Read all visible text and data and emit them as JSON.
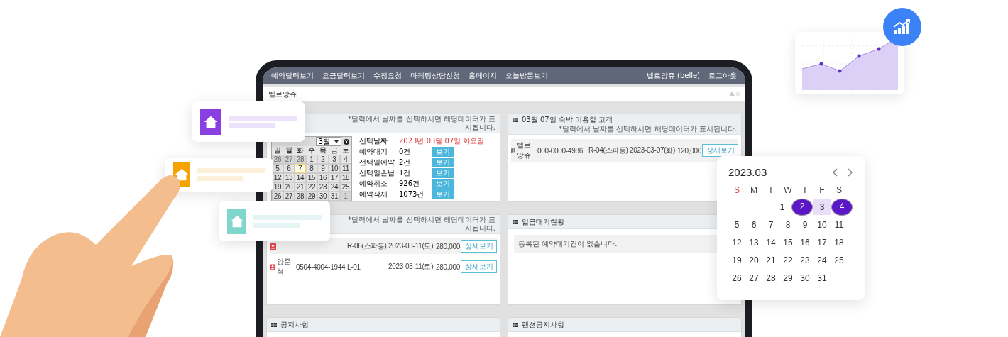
{
  "nav": {
    "items": [
      "예약달력보기",
      "요금달력보기",
      "수정요청",
      "마케팅상담신청",
      "홈페이지",
      "오늘방문보기"
    ],
    "user": "벨르망쥬 (belle)",
    "logout": "로그아웃"
  },
  "page_title": "벨르망쥬",
  "calendar_panel": {
    "note": "*달력에서 날짜를 선택하시면 해당데이터가 표시됩니다.",
    "month": "3월",
    "weekdays": [
      "일",
      "월",
      "화",
      "수",
      "목",
      "금",
      "토"
    ],
    "weeks": [
      [
        {
          "label": "26",
          "muted": true,
          "today": false
        },
        {
          "label": "27",
          "muted": true,
          "today": false
        },
        {
          "label": "28",
          "muted": true,
          "today": false
        },
        {
          "label": "1",
          "muted": false,
          "today": false
        },
        {
          "label": "2",
          "muted": false,
          "today": false
        },
        {
          "label": "3",
          "muted": false,
          "today": false
        },
        {
          "label": "4",
          "muted": false,
          "today": false
        }
      ],
      [
        {
          "label": "5",
          "muted": false,
          "today": false
        },
        {
          "label": "6",
          "muted": false,
          "today": false
        },
        {
          "label": "7",
          "muted": false,
          "today": true
        },
        {
          "label": "8",
          "muted": false,
          "today": false
        },
        {
          "label": "9",
          "muted": false,
          "today": false
        },
        {
          "label": "10",
          "muted": false,
          "today": false
        },
        {
          "label": "11",
          "muted": false,
          "today": false
        }
      ],
      [
        {
          "label": "12",
          "muted": false,
          "today": false
        },
        {
          "label": "13",
          "muted": false,
          "today": false
        },
        {
          "label": "14",
          "muted": false,
          "today": false
        },
        {
          "label": "15",
          "muted": false,
          "today": false
        },
        {
          "label": "16",
          "muted": false,
          "today": false
        },
        {
          "label": "17",
          "muted": false,
          "today": false
        },
        {
          "label": "18",
          "muted": false,
          "today": false
        }
      ],
      [
        {
          "label": "19",
          "muted": false,
          "today": false
        },
        {
          "label": "20",
          "muted": false,
          "today": false
        },
        {
          "label": "21",
          "muted": false,
          "today": false
        },
        {
          "label": "22",
          "muted": false,
          "today": false
        },
        {
          "label": "23",
          "muted": false,
          "today": false
        },
        {
          "label": "24",
          "muted": false,
          "today": false
        },
        {
          "label": "25",
          "muted": false,
          "today": false
        }
      ],
      [
        {
          "label": "26",
          "muted": false,
          "today": false
        },
        {
          "label": "27",
          "muted": false,
          "today": false
        },
        {
          "label": "28",
          "muted": false,
          "today": false
        },
        {
          "label": "29",
          "muted": false,
          "today": false
        },
        {
          "label": "30",
          "muted": false,
          "today": false
        },
        {
          "label": "31",
          "muted": false,
          "today": false
        },
        {
          "label": "1",
          "muted": true,
          "today": false
        }
      ]
    ],
    "selected_date_label": "선택날짜",
    "selected_date": "2023년 03월 07일 화요일",
    "stats": [
      {
        "label": "예약대기",
        "value": "0건",
        "button": "보기"
      },
      {
        "label": "선택일예약",
        "value": "2건",
        "button": "보기"
      },
      {
        "label": "선택일손님",
        "value": "1건",
        "button": "보기"
      },
      {
        "label": "예약취소",
        "value": "926건",
        "button": "보기"
      },
      {
        "label": "예약삭제",
        "value": "1073건",
        "button": "보기"
      }
    ]
  },
  "guests_panel": {
    "title": "03월 07일 숙박 이용할 고객",
    "note": "*달력에서 날짜를 선택하시면 해당데이터가 표시됩니다.",
    "rows": [
      {
        "name": "벨르망쥬",
        "phone": "000-0000-4986",
        "room": "R-04(스파동)",
        "date": "2023-03-07(화)",
        "price": "120,000",
        "button": "상세보기"
      }
    ]
  },
  "reservations_panel": {
    "note": "*달력에서 날짜를 선택하시면 해당데이터가 표시됩니다.",
    "rows": [
      {
        "room": "R-06(스파동)",
        "date": "2023-03-11(토)",
        "price": "280,000",
        "button": "상세보기"
      },
      {
        "name": "양준혁",
        "phone": "0504-4004-1944",
        "room": "L-01",
        "date": "2023-03-11(토)",
        "price": "280,000",
        "button": "상세보기"
      }
    ]
  },
  "deposit_panel": {
    "title": "입금대기현황",
    "message": "등록된 예약대기건이 없습니다."
  },
  "notice_panels": [
    {
      "title": "공지사항"
    },
    {
      "title": "펜션공지사항"
    }
  ],
  "date_picker": {
    "title": "2023.03",
    "weekdays": [
      {
        "label": "S",
        "kind": "sunday"
      },
      {
        "label": "M",
        "kind": "weekday"
      },
      {
        "label": "T",
        "kind": "weekday"
      },
      {
        "label": "W",
        "kind": "weekday"
      },
      {
        "label": "T",
        "kind": "weekday"
      },
      {
        "label": "F",
        "kind": "weekday"
      },
      {
        "label": "S",
        "kind": "weekday"
      }
    ],
    "weeks": [
      [
        {
          "label": "1",
          "selected": false,
          "in_range": false
        },
        {
          "label": "2",
          "selected": true,
          "in_range": false
        },
        {
          "label": "3",
          "selected": false,
          "in_range": true
        },
        {
          "label": "4",
          "selected": true,
          "in_range": false
        }
      ],
      [
        {
          "label": "5",
          "selected": false,
          "in_range": false
        },
        {
          "label": "6",
          "selected": false,
          "in_range": false
        },
        {
          "label": "7",
          "selected": false,
          "in_range": false
        },
        {
          "label": "8",
          "selected": false,
          "in_range": false
        },
        {
          "label": "9",
          "selected": false,
          "in_range": false
        },
        {
          "label": "10",
          "selected": false,
          "in_range": false
        },
        {
          "label": "11",
          "selected": false,
          "in_range": false
        }
      ],
      [
        {
          "label": "12",
          "selected": false,
          "in_range": false
        },
        {
          "label": "13",
          "selected": false,
          "in_range": false
        },
        {
          "label": "14",
          "selected": false,
          "in_range": false
        },
        {
          "label": "15",
          "selected": false,
          "in_range": false
        },
        {
          "label": "16",
          "selected": false,
          "in_range": false
        },
        {
          "label": "17",
          "selected": false,
          "in_range": false
        },
        {
          "label": "18",
          "selected": false,
          "in_range": false
        }
      ],
      [
        {
          "label": "19",
          "selected": false,
          "in_range": false
        },
        {
          "label": "20",
          "selected": false,
          "in_range": false
        },
        {
          "label": "21",
          "selected": false,
          "in_range": false
        },
        {
          "label": "22",
          "selected": false,
          "in_range": false
        },
        {
          "label": "23",
          "selected": false,
          "in_range": false
        },
        {
          "label": "24",
          "selected": false,
          "in_range": false
        },
        {
          "label": "25",
          "selected": false,
          "in_range": false
        }
      ],
      [
        {
          "label": "26",
          "selected": false,
          "in_range": false
        },
        {
          "label": "27",
          "selected": false,
          "in_range": false
        },
        {
          "label": "28",
          "selected": false,
          "in_range": false
        },
        {
          "label": "29",
          "selected": false,
          "in_range": false
        },
        {
          "label": "30",
          "selected": false,
          "in_range": false
        },
        {
          "label": "31",
          "selected": false,
          "in_range": false
        }
      ]
    ]
  },
  "floating_cards": [
    {
      "color": "#8a3fe0"
    },
    {
      "color": "#f5a300"
    },
    {
      "color": "#7fd6cc"
    }
  ]
}
